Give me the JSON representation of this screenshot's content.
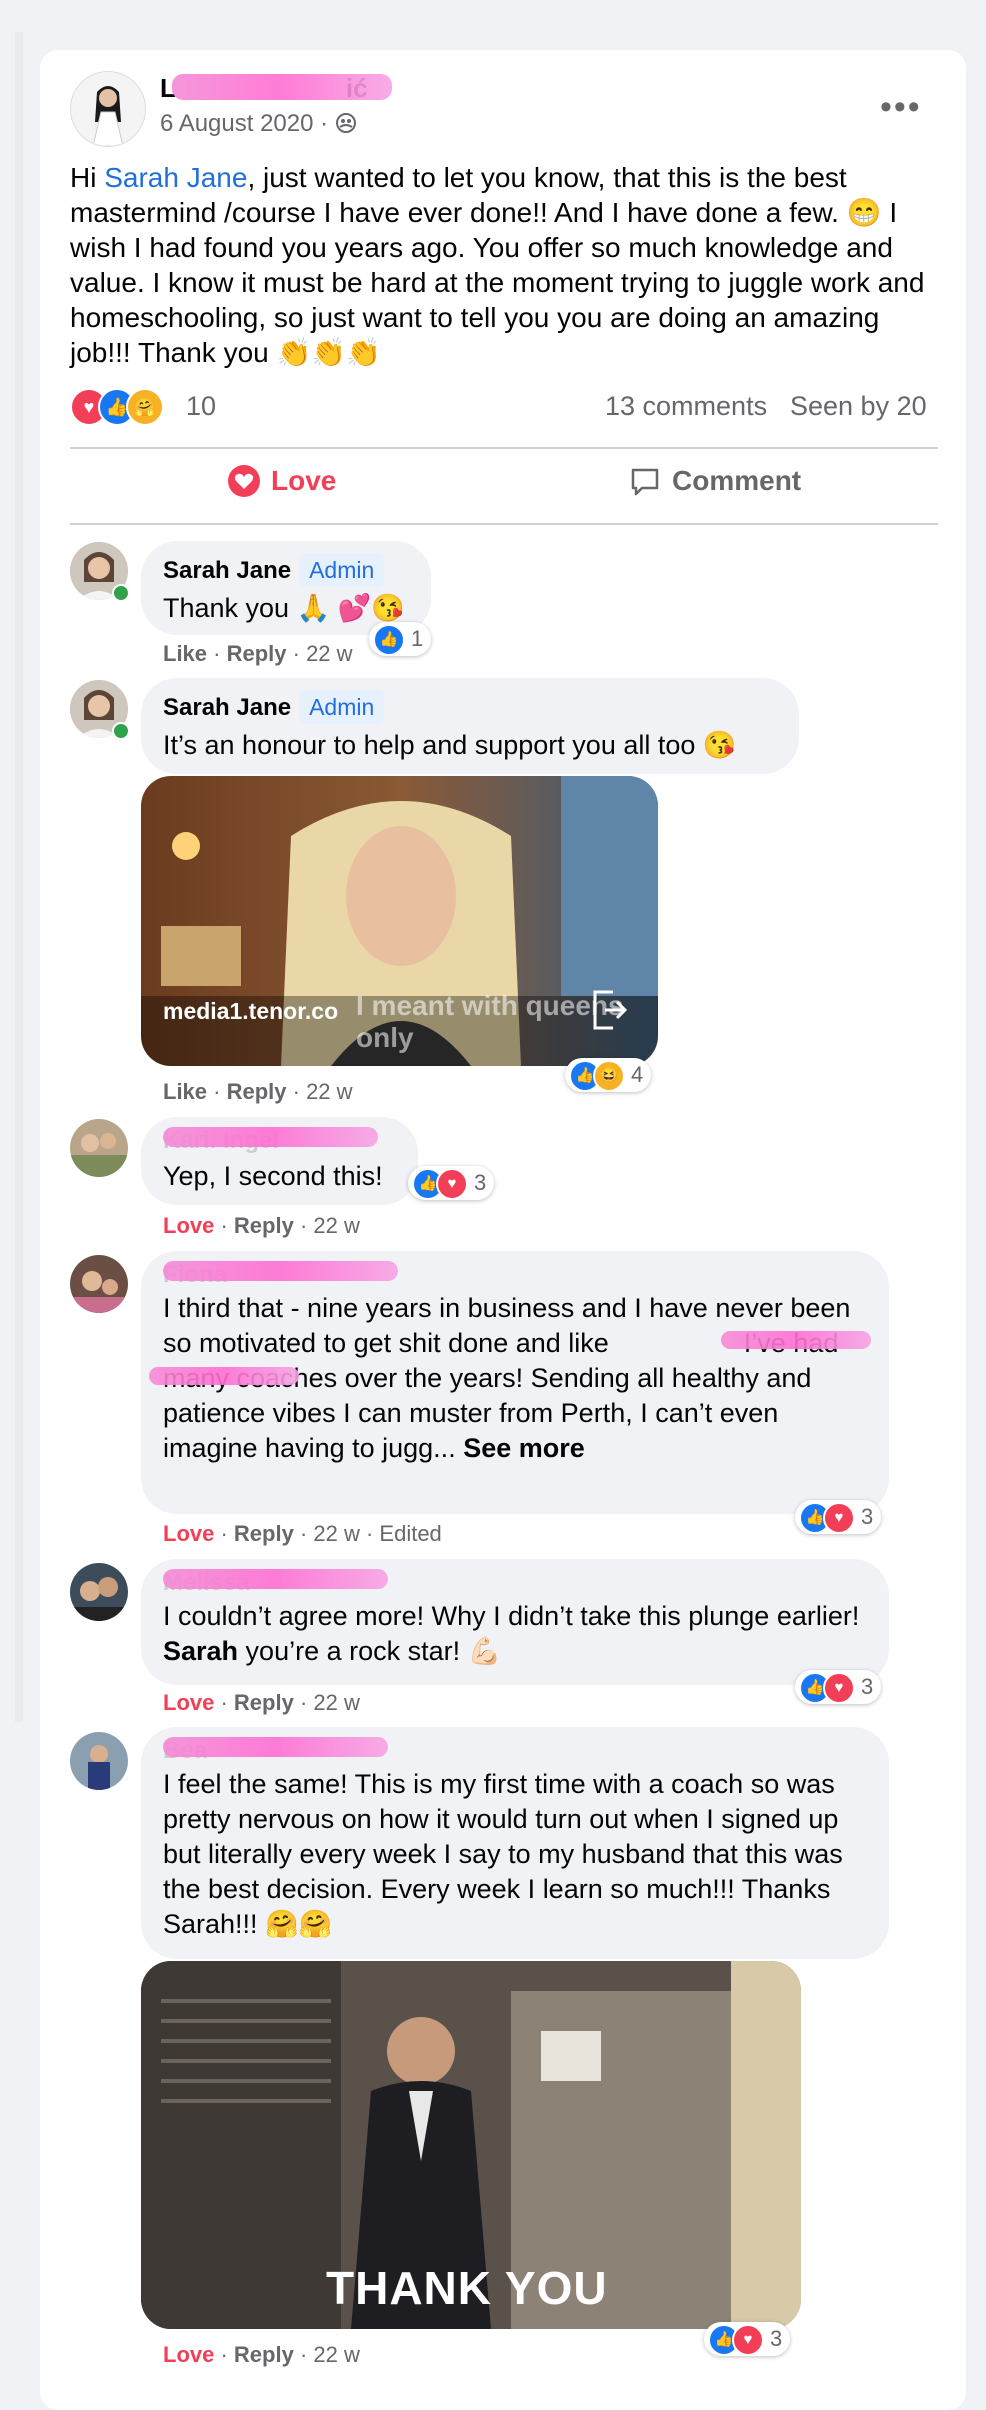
{
  "post": {
    "date": "6 August 2020 · ",
    "audience_icon": "group-audience-icon",
    "author_visible": "L",
    "author_visible_end": "ić",
    "text_greeting": "Hi ",
    "mention": "Sarah Jane",
    "text_body": ", just wanted to let you know, that this is the best mastermind /course I have ever done!! And I have done a few. 😁 I wish I had found you years ago. You offer so much knowledge and value. I know it must be hard at the moment trying to juggle work and homeschooling, so just want to tell you you are doing an amazing job!!! Thank you 👏👏👏",
    "reaction_count": "10",
    "comments_count": "13 comments",
    "seen_by": "Seen by 20",
    "love_label": "Love",
    "comment_label": "Comment"
  },
  "comments": [
    {
      "name": "Sarah Jane",
      "badge": "Admin",
      "text": "Thank you 🙏 💕😘",
      "like": "Like",
      "reply": "Reply",
      "time": " · 22 w",
      "reaction_count": "1"
    },
    {
      "name": "Sarah Jane",
      "badge": "Admin",
      "text": "It’s an honour to help and support you all too 😘",
      "gif_source": "media1.tenor.co",
      "gif_caption": "I meant with queens only",
      "like": "Like",
      "reply": "Reply",
      "time": " · 22 w",
      "reaction_count": "4"
    },
    {
      "name": "Kari. Ingel",
      "text": "Yep, I second this!",
      "love": "Love",
      "reply": "Reply",
      "time": " · 22 w",
      "reaction_count": "3"
    },
    {
      "name": "Fiona",
      "text_a": "I third that - nine years in business and I have never been so motivated to get shit done and like ",
      "text_b": " I’ve had many coaches over the years! Sending all healthy and patience vibes I can muster from Perth, I can’t even imagine having to jugg... ",
      "see_more": "See more",
      "love": "Love",
      "reply": "Reply",
      "time": " · 22 w · Edited",
      "reaction_count": "3"
    },
    {
      "name": "Melissa",
      "text_a": "I couldn’t agree more! Why I didn’t take this plunge earlier! ",
      "bold": "Sarah",
      "text_b": " you’re a rock star! 💪🏻",
      "love": "Love",
      "reply": "Reply",
      "time": " · 22 w",
      "reaction_count": "3"
    },
    {
      "name": "Bea",
      "text": "I feel the same! This is my first time with a coach so was pretty nervous on how it would turn out when I signed up but literally every week I say to my husband that this was the best decision. Every week I learn so much!!! Thanks Sarah!!! 🤗🤗",
      "gif_caption": "THANK YOU",
      "love": "Love",
      "reply": "Reply",
      "time": " · 22 w",
      "reaction_count": "3"
    }
  ],
  "colors": {
    "accent_blue": "#216fdb",
    "love_red": "#f33e58",
    "bubble_bg": "#f0f2f5",
    "muted": "#65676b"
  }
}
